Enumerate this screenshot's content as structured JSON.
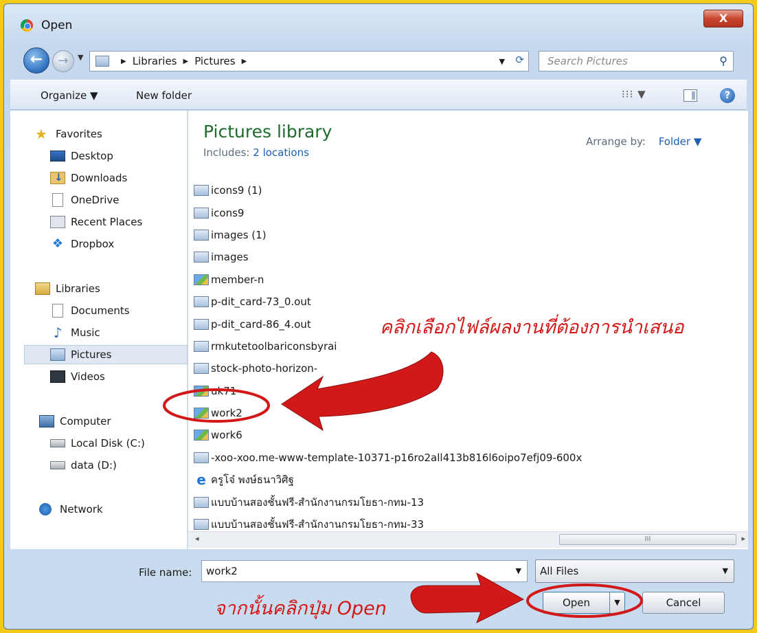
{
  "window": {
    "title": "Open",
    "close_label": "X"
  },
  "nav": {
    "back": "←",
    "forward": "→"
  },
  "address": {
    "crumbs": [
      "Libraries",
      "Pictures"
    ]
  },
  "search": {
    "placeholder": "Search Pictures"
  },
  "toolbar": {
    "organize": "Organize ▼",
    "new_folder": "New folder",
    "views": "⁝⁝⁝ ▼",
    "help": "?"
  },
  "sidebar": {
    "favorites": "Favorites",
    "desktop": "Desktop",
    "downloads": "Downloads",
    "onedrive": "OneDrive",
    "recent": "Recent Places",
    "dropbox": "Dropbox",
    "libraries": "Libraries",
    "documents": "Documents",
    "music": "Music",
    "pictures": "Pictures",
    "videos": "Videos",
    "computer": "Computer",
    "local_disk": "Local Disk (C:)",
    "data_disk": "data (D:)",
    "network": "Network"
  },
  "library": {
    "title": "Pictures library",
    "includes_label": "Includes:",
    "includes_link": "2 locations",
    "arrange_label": "Arrange by:",
    "arrange_value": "Folder ▼"
  },
  "files": [
    {
      "name": "icons9 (1)",
      "icon": "folder"
    },
    {
      "name": "icons9",
      "icon": "folder"
    },
    {
      "name": "images (1)",
      "icon": "folder"
    },
    {
      "name": "images",
      "icon": "folder"
    },
    {
      "name": "member-n",
      "icon": "image"
    },
    {
      "name": "p-dit_card-73_0.out",
      "icon": "folder"
    },
    {
      "name": "p-dit_card-86_4.out",
      "icon": "folder"
    },
    {
      "name": "rmkutetoolbariconsbyrai",
      "icon": "folder"
    },
    {
      "name": "stock-photo-horizon-",
      "icon": "folder"
    },
    {
      "name": "uk71",
      "icon": "image"
    },
    {
      "name": "work2",
      "icon": "image"
    },
    {
      "name": "work6",
      "icon": "image"
    },
    {
      "name": "-xoo-xoo.me-www-template-10371-p16ro2all413b816l6oipo7efj09-600x",
      "icon": "folder"
    },
    {
      "name": "ครูโจ๋ พงษ์ธนาวิศิฐ",
      "icon": "ie"
    },
    {
      "name": "แบบบ้านสองชั้นฟรี-สำนักงานกรมโยธา-กทม-13",
      "icon": "folder"
    },
    {
      "name": "แบบบ้านสองชั้นฟรี-สำนักงานกรมโยธา-กทม-33",
      "icon": "folder"
    }
  ],
  "scrollbar": {
    "left": "◂",
    "thumb": "III",
    "right": "▸"
  },
  "footer": {
    "filename_label": "File name:",
    "filename_value": "work2",
    "filetype": "All Files",
    "open_label": "Open",
    "cancel_label": "Cancel"
  },
  "annotations": {
    "select_file": "คลิกเลือกไฟล์ผลงานที่ต้องการนำเสนอ",
    "click_open": "จากนั้นคลิกปุ่ม Open",
    "color": "#d21818"
  },
  "colors": {
    "frame": "#f3c91c",
    "library_title": "#1e6b2e",
    "link": "#1a5fb4"
  }
}
